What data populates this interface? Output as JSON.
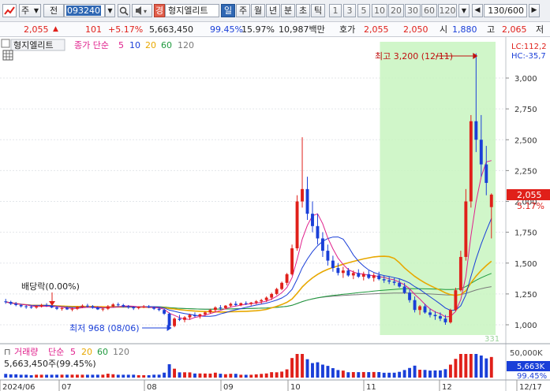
{
  "toolbar": {
    "market": "주",
    "scope": "전",
    "code": "093240",
    "name_badge": "경",
    "stock_name": "형지엘리트",
    "periods": [
      "일",
      "주",
      "월",
      "년",
      "분",
      "초",
      "틱"
    ],
    "period_selected": "일",
    "minute_steps": [
      "1",
      "3",
      "5",
      "10",
      "20",
      "30",
      "60",
      "120"
    ],
    "count_display": "130/600"
  },
  "quote": {
    "price": "2,055",
    "change": "101",
    "change_pct": "+5.17%",
    "volume": "5,663,450",
    "volume_ratio": "99.45%",
    "turnover": "15.97%",
    "amount": "10,987백만",
    "ask_label": "호가",
    "ask": "2,055",
    "bid": "2,050",
    "open_label": "시",
    "open": "1,880",
    "high_label": "고",
    "high": "2,065",
    "low_label": "저"
  },
  "chart": {
    "legend_name": "형지엘리트",
    "legend_ma_label": "종가 단순",
    "ma_periods": [
      "5",
      "10",
      "20",
      "60",
      "120"
    ],
    "ma_colors": [
      "#e0208c",
      "#1a3fd8",
      "#e8a800",
      "#1f9a3e",
      "#7a7a7a"
    ],
    "lc_label": "LC:112,2",
    "hc_label": "HC:-35,7",
    "high_annotation": "최고 3,200 (12/11)",
    "low_annotation": "최저 968 (08/06)",
    "dividend_annotation": "배당락(0.00%)",
    "corner_label": "331",
    "price_badge": "2,055",
    "pct_badge": "5.17%",
    "y_ticks": [
      "3,000",
      "2,750",
      "2,500",
      "2,250",
      "2,000",
      "1,750",
      "1,500",
      "1,250",
      "1,000"
    ],
    "volume_legend_label": "거래량",
    "volume_ma_label": "단순",
    "volume_ma_periods": [
      "5",
      "20",
      "60",
      "120"
    ],
    "volume_value": "5,663,450주(99.45%)",
    "volume_ticks": [
      "50,000K"
    ],
    "volume_badge": "5,663K",
    "volume_pct_badge": "99.45%",
    "x_labels": [
      "2024/06",
      "07",
      "08",
      "09",
      "10",
      "11",
      "12",
      "12/17"
    ]
  },
  "chart_data": {
    "type": "candlestick",
    "ylim": [
      900,
      3300
    ],
    "highlight_period": "11 - 12/17",
    "high": {
      "value": 3200,
      "date": "12/11"
    },
    "low": {
      "value": 968,
      "date": "08/06"
    },
    "candles": [
      [
        1190,
        1210,
        1170,
        1185
      ],
      [
        1185,
        1195,
        1160,
        1170
      ],
      [
        1170,
        1185,
        1150,
        1160
      ],
      [
        1160,
        1170,
        1140,
        1150
      ],
      [
        1150,
        1160,
        1130,
        1145
      ],
      [
        1145,
        1155,
        1130,
        1140
      ],
      [
        1140,
        1160,
        1130,
        1150
      ],
      [
        1150,
        1170,
        1140,
        1160
      ],
      [
        1160,
        1175,
        1145,
        1155
      ],
      [
        1155,
        1165,
        1135,
        1140
      ],
      [
        1140,
        1150,
        1120,
        1130
      ],
      [
        1130,
        1145,
        1115,
        1135
      ],
      [
        1135,
        1150,
        1120,
        1125
      ],
      [
        1125,
        1140,
        1110,
        1130
      ],
      [
        1130,
        1150,
        1120,
        1145
      ],
      [
        1145,
        1165,
        1135,
        1155
      ],
      [
        1155,
        1170,
        1140,
        1150
      ],
      [
        1150,
        1160,
        1130,
        1140
      ],
      [
        1140,
        1150,
        1120,
        1125
      ],
      [
        1125,
        1140,
        1110,
        1130
      ],
      [
        1130,
        1160,
        1120,
        1150
      ],
      [
        1150,
        1175,
        1140,
        1165
      ],
      [
        1165,
        1180,
        1150,
        1160
      ],
      [
        1160,
        1170,
        1140,
        1150
      ],
      [
        1150,
        1160,
        1130,
        1140
      ],
      [
        1140,
        1150,
        1120,
        1135
      ],
      [
        1135,
        1150,
        1125,
        1145
      ],
      [
        1145,
        1160,
        1135,
        1150
      ],
      [
        1150,
        1160,
        1135,
        1140
      ],
      [
        1140,
        1150,
        1120,
        1130
      ],
      [
        1130,
        1140,
        1110,
        1120
      ],
      [
        1120,
        1130,
        1080,
        1090
      ],
      [
        1090,
        1100,
        968,
        990
      ],
      [
        990,
        1060,
        980,
        1050
      ],
      [
        1050,
        1080,
        1030,
        1040
      ],
      [
        1040,
        1070,
        1020,
        1060
      ],
      [
        1060,
        1090,
        1040,
        1080
      ],
      [
        1080,
        1100,
        1060,
        1070
      ],
      [
        1070,
        1090,
        1050,
        1085
      ],
      [
        1085,
        1110,
        1070,
        1100
      ],
      [
        1100,
        1130,
        1090,
        1120
      ],
      [
        1120,
        1150,
        1100,
        1140
      ],
      [
        1140,
        1160,
        1120,
        1135
      ],
      [
        1135,
        1160,
        1125,
        1155
      ],
      [
        1155,
        1180,
        1140,
        1170
      ],
      [
        1170,
        1190,
        1150,
        1160
      ],
      [
        1160,
        1180,
        1150,
        1175
      ],
      [
        1175,
        1190,
        1160,
        1170
      ],
      [
        1170,
        1185,
        1155,
        1180
      ],
      [
        1180,
        1200,
        1165,
        1190
      ],
      [
        1190,
        1210,
        1170,
        1200
      ],
      [
        1200,
        1230,
        1185,
        1220
      ],
      [
        1220,
        1260,
        1200,
        1250
      ],
      [
        1250,
        1300,
        1240,
        1290
      ],
      [
        1290,
        1350,
        1280,
        1340
      ],
      [
        1340,
        1420,
        1320,
        1410
      ],
      [
        1410,
        1650,
        1400,
        1620
      ],
      [
        1620,
        2050,
        1600,
        2000
      ],
      [
        2000,
        2520,
        1950,
        2100
      ],
      [
        2100,
        2200,
        1850,
        1900
      ],
      [
        1900,
        2000,
        1750,
        1800
      ],
      [
        1800,
        1900,
        1650,
        1700
      ],
      [
        1700,
        1750,
        1550,
        1600
      ],
      [
        1600,
        1650,
        1480,
        1520
      ],
      [
        1520,
        1560,
        1430,
        1460
      ],
      [
        1460,
        1500,
        1400,
        1420
      ],
      [
        1420,
        1470,
        1380,
        1440
      ],
      [
        1440,
        1460,
        1390,
        1400
      ],
      [
        1400,
        1440,
        1370,
        1420
      ],
      [
        1420,
        1450,
        1380,
        1390
      ],
      [
        1390,
        1430,
        1360,
        1410
      ],
      [
        1410,
        1440,
        1370,
        1380
      ],
      [
        1380,
        1420,
        1350,
        1400
      ],
      [
        1400,
        1430,
        1360,
        1370
      ],
      [
        1370,
        1400,
        1340,
        1360
      ],
      [
        1360,
        1390,
        1330,
        1350
      ],
      [
        1350,
        1380,
        1320,
        1340
      ],
      [
        1340,
        1370,
        1300,
        1310
      ],
      [
        1310,
        1340,
        1250,
        1260
      ],
      [
        1260,
        1290,
        1180,
        1200
      ],
      [
        1200,
        1230,
        1100,
        1120
      ],
      [
        1120,
        1160,
        1080,
        1150
      ],
      [
        1150,
        1170,
        1090,
        1100
      ],
      [
        1100,
        1130,
        1060,
        1080
      ],
      [
        1080,
        1110,
        1040,
        1070
      ],
      [
        1070,
        1100,
        1030,
        1050
      ],
      [
        1050,
        1080,
        1000,
        1020
      ],
      [
        1020,
        1130,
        1010,
        1120
      ],
      [
        1120,
        1300,
        1110,
        1280
      ],
      [
        1280,
        1600,
        1270,
        1550
      ],
      [
        1550,
        2100,
        1520,
        2000
      ],
      [
        2000,
        2700,
        1950,
        2650
      ],
      [
        2650,
        3200,
        2400,
        2500
      ],
      [
        2500,
        2700,
        2200,
        2300
      ],
      [
        2300,
        2450,
        2050,
        2150
      ],
      [
        1954,
        2065,
        1700,
        2055
      ]
    ],
    "ma_series": [
      {
        "name": "5",
        "color": "#e0208c"
      },
      {
        "name": "10",
        "color": "#1a3fd8"
      },
      {
        "name": "20",
        "color": "#e8a800"
      },
      {
        "name": "60",
        "color": "#1f9a3e"
      },
      {
        "name": "120",
        "color": "#7a7a7a"
      }
    ],
    "volume_scale_max": 60000,
    "volume_unit": "K"
  }
}
